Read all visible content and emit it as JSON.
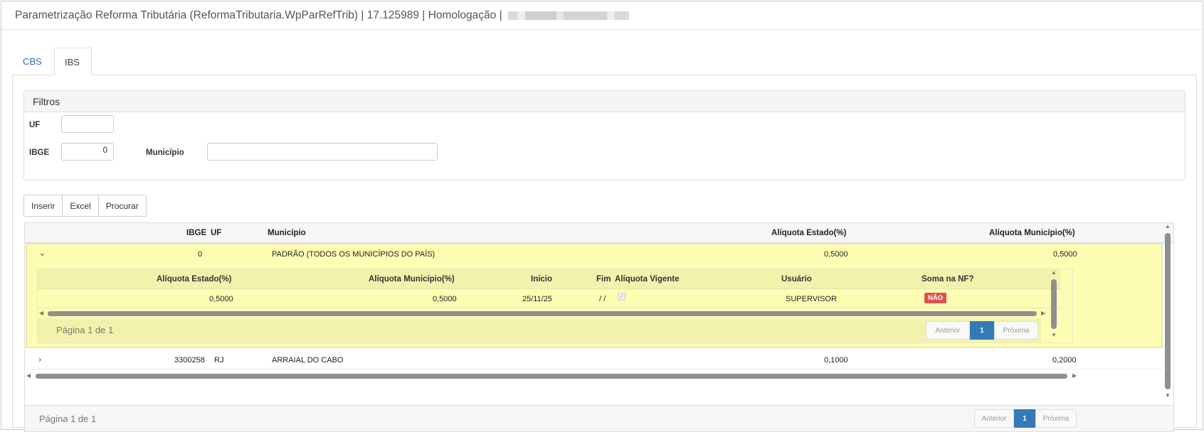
{
  "window": {
    "title": "Parametrização Reforma Tributária (ReformaTributaria.WpParRefTrib) | 17.125989 | Homologação |"
  },
  "tabs": [
    {
      "label": "CBS",
      "active": false
    },
    {
      "label": "IBS",
      "active": true
    }
  ],
  "filters": {
    "title": "Filtros",
    "uf_label": "UF",
    "uf_value": "",
    "ibge_label": "IBGE",
    "ibge_value": "0",
    "municipio_label": "Município",
    "municipio_value": ""
  },
  "toolbar": {
    "insert_label": "Inserir",
    "excel_label": "Excel",
    "search_label": "Procurar"
  },
  "grid": {
    "columns": {
      "ibge": "IBGE",
      "uf": "UF",
      "municipio": "Município",
      "aliquota_estado": "Alíquota Estado(%)",
      "aliquota_municipio": "Alíquota Município(%)"
    },
    "rows": [
      {
        "ibge": "0",
        "uf": "",
        "municipio": "PADRÃO (TODOS OS MUNICÍPIOS DO PAÍS)",
        "aliquota_estado": "0,5000",
        "aliquota_municipio": "0,5000",
        "expanded": true
      },
      {
        "ibge": "3300258",
        "uf": "RJ",
        "municipio": "ARRAIAL DO CABO",
        "aliquota_estado": "0,1000",
        "aliquota_municipio": "0,2000",
        "expanded": false
      }
    ],
    "page_text": "Página 1 de 1",
    "pager": {
      "prev": "Anterior",
      "page": "1",
      "next": "Próxima"
    }
  },
  "detail": {
    "columns": {
      "aliquota_estado": "Alíquota Estado(%)",
      "aliquota_municipio": "Alíquota Município(%)",
      "inicio": "Início",
      "fim": "Fim",
      "aliquota_vigente": "Alíquota Vigente",
      "usuario": "Usuário",
      "soma_nf": "Soma na NF?"
    },
    "row": {
      "aliquota_estado": "0,5000",
      "aliquota_municipio": "0,5000",
      "inicio": "25/11/25",
      "fim": "/ /",
      "aliquota_vigente_checked": true,
      "usuario": "SUPERVISOR",
      "soma_nf": "NÃO"
    },
    "page_text": "Página 1 de 1",
    "pager": {
      "prev": "Anterior",
      "page": "1",
      "next": "Próxima"
    }
  },
  "colors": {
    "link": "#2a6ebb",
    "active_page": "#337ab7",
    "highlight_row": "#fdfdb3",
    "badge_danger": "#d9534f"
  }
}
